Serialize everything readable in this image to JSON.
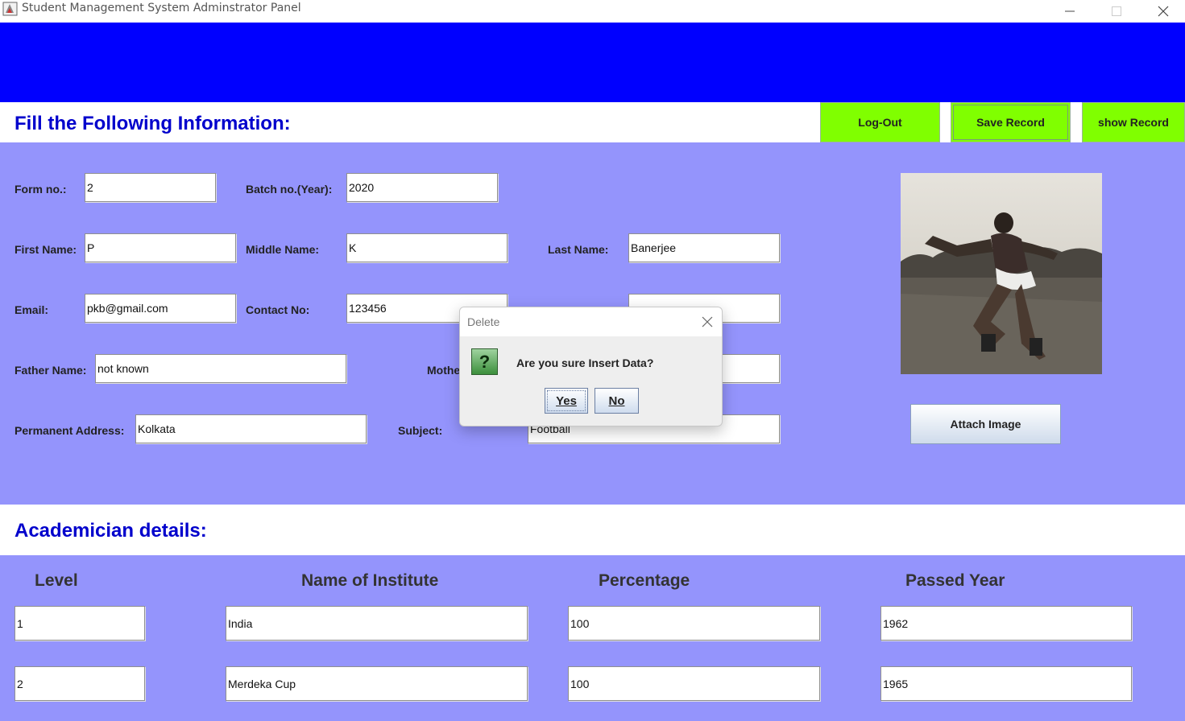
{
  "window": {
    "title": "Student Management System Adminstrator Panel",
    "icons": {
      "app": "java-app-icon",
      "minimize": "minimize-icon",
      "maximize": "maximize-icon",
      "close": "close-icon"
    }
  },
  "colors": {
    "banner": "#0000ff",
    "panel": "#9494fc",
    "accent_button": "#80ff00",
    "heading": "#0000cc"
  },
  "header": {
    "title": "Fill the Following Information:",
    "buttons": {
      "logout": "Log-Out",
      "save": "Save Record",
      "show": "show Record"
    }
  },
  "form": {
    "form_no": {
      "label": "Form no.:",
      "value": "2"
    },
    "batch_no": {
      "label": "Batch no.(Year):",
      "value": "2020"
    },
    "first_name": {
      "label": "First Name:",
      "value": "P"
    },
    "middle_name": {
      "label": "Middle Name:",
      "value": "K"
    },
    "last_name": {
      "label": "Last Name:",
      "value": "Banerjee"
    },
    "email": {
      "label": "Email:",
      "value": "pkb@gmail.com"
    },
    "contact_no": {
      "label": "Contact No:",
      "value": "123456"
    },
    "father_name": {
      "label": "Father Name:",
      "value": "not known"
    },
    "mother_name": {
      "label": "Mothe",
      "value": ""
    },
    "permanent_address": {
      "label": "Permanent Address:",
      "value": "Kolkata"
    },
    "subject": {
      "label": "Subject:",
      "value": "Football"
    },
    "attach_image_label": "Attach Image"
  },
  "academic": {
    "title": "Academician details:",
    "columns": [
      "Level",
      "Name of Institute",
      "Percentage",
      "Passed Year"
    ],
    "rows": [
      {
        "level": "1",
        "institute": "India",
        "percentage": "100",
        "year": "1962"
      },
      {
        "level": "2",
        "institute": "Merdeka Cup",
        "percentage": "100",
        "year": "1965"
      }
    ]
  },
  "dialog": {
    "title": "Delete",
    "message": "Are you sure Insert Data?",
    "icon": "question-icon",
    "icon_glyph": "?",
    "yes": "Yes",
    "no": "No"
  }
}
